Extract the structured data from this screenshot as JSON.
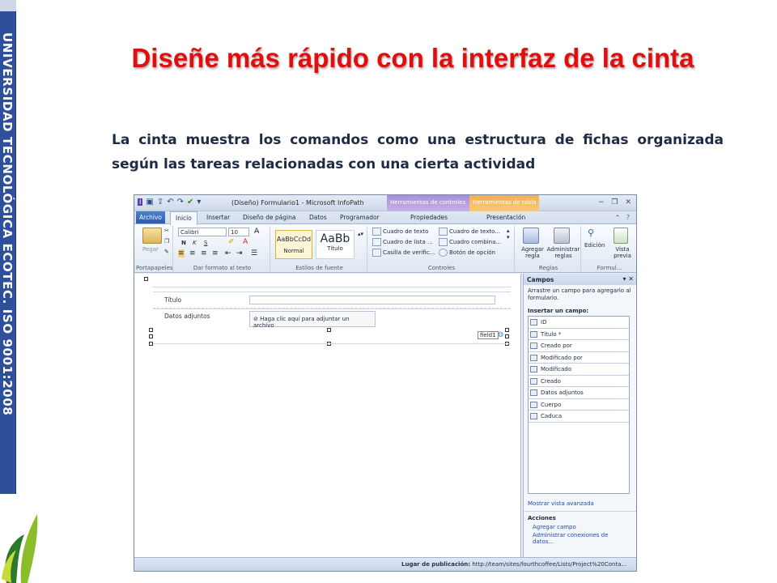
{
  "sidebar_text": "UNIVERSIDAD TECNOLÓGICA ECOTEC. ISO 9001:2008",
  "slide": {
    "title": "Diseñe más rápido con la interfaz de la cinta",
    "subtitle": "La cinta muestra los comandos como una estructura de fichas organizada según las tareas relacionadas con una cierta actividad"
  },
  "app": {
    "window_title": "(Diseño) Formulario1  -  Microsoft InfoPath",
    "context_tab_1": "Herramientas de controles",
    "context_tab_2": "Herramientas de tabla",
    "tabs": [
      "Archivo",
      "Inicio",
      "Insertar",
      "Diseño de página",
      "Datos",
      "Programador"
    ],
    "context_labels": [
      "Propiedades",
      "Presentación"
    ],
    "ribbon": {
      "paste": "Pegar",
      "font": "Calibri",
      "size": "10",
      "bold": "N",
      "italic": "K",
      "underline": "S",
      "style1_sample": "AaBbCcDd",
      "style1_name": "Normal",
      "style2_sample": "AaBb",
      "style2_name": "Título",
      "controls": [
        "Cuadro de texto",
        "Cuadro de lista ...",
        "Casilla de verific...",
        "Cuadro de texto...",
        "Cuadro combina...",
        "Botón de opción"
      ],
      "add_rule": "Agregar regla",
      "manage_rules": "Administrar reglas",
      "edit": "Edición",
      "preview": "Vista previa",
      "groups": [
        "Portapapeles",
        "Dar formato al texto",
        "Estilos de fuente",
        "Controles",
        "Reglas",
        "Formul..."
      ]
    },
    "form": {
      "row1_label": "Título",
      "row2_label": "Datos adjuntos",
      "attach_text": "Haga clic aquí para adjuntar un archivo",
      "field_tag": "field1"
    },
    "pane": {
      "title": "Campos",
      "intro": "Arrastre un campo para agregarlo al formulario.",
      "insert_label": "Insertar un campo:",
      "fields": [
        "ID",
        "Título *",
        "Creado por",
        "Modificado por",
        "Modificado",
        "Creado",
        "Datos adjuntos",
        "Cuerpo",
        "Caduca"
      ],
      "advanced": "Mostrar vista avanzada",
      "actions_label": "Acciones",
      "actions": [
        "Agregar campo",
        "Administrar conexiones de datos..."
      ]
    },
    "status": {
      "label": "Lugar de publicación:",
      "url": "http://team/sites/fourthcoffee/Lists/Project%20Conta..."
    }
  }
}
